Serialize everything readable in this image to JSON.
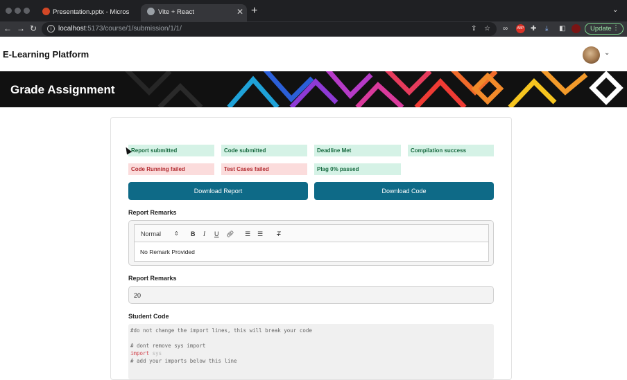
{
  "browser": {
    "tabs": [
      {
        "title": "Presentation.pptx - Microsoft P",
        "icon": "powerpoint-icon",
        "active": false
      },
      {
        "title": "Vite + React",
        "icon": "globe-icon",
        "active": true
      }
    ],
    "url_host": "localhost",
    "url_path": ":5173/course/1/submission/1/1/",
    "update_label": "Update"
  },
  "app": {
    "brand": "E-Learning Platform",
    "page_title": "Grade Assignment"
  },
  "status": {
    "row1": [
      {
        "label": "Report submitted",
        "state": "ok"
      },
      {
        "label": "Code submitted",
        "state": "ok"
      },
      {
        "label": "Deadline Met",
        "state": "ok"
      },
      {
        "label": "Compilation success",
        "state": "ok"
      }
    ],
    "row2": [
      {
        "label": "Code Running failed",
        "state": "bad"
      },
      {
        "label": "Test Cases failed",
        "state": "bad"
      },
      {
        "label": "Plag 0% passed",
        "state": "ok"
      }
    ]
  },
  "actions": {
    "download_report": "Download Report",
    "download_code": "Download Code"
  },
  "remarks": {
    "label": "Report Remarks",
    "format_select": "Normal",
    "text": "No Remark Provided"
  },
  "score": {
    "label": "Report Remarks",
    "value": "20"
  },
  "code": {
    "label": "Student Code",
    "lines": {
      "l1": "#do not change the import lines, this will break your code",
      "l2": "# dont remove sys import",
      "l3_kw": "import",
      "l3_rest": " sys",
      "l4": "# add your imports below this line"
    }
  },
  "colors": {
    "primary": "#0e6a87",
    "ok_bg": "#d5f2e6",
    "ok_text": "#17693f",
    "bad_bg": "#fbdcdc",
    "bad_text": "#b1292e"
  }
}
